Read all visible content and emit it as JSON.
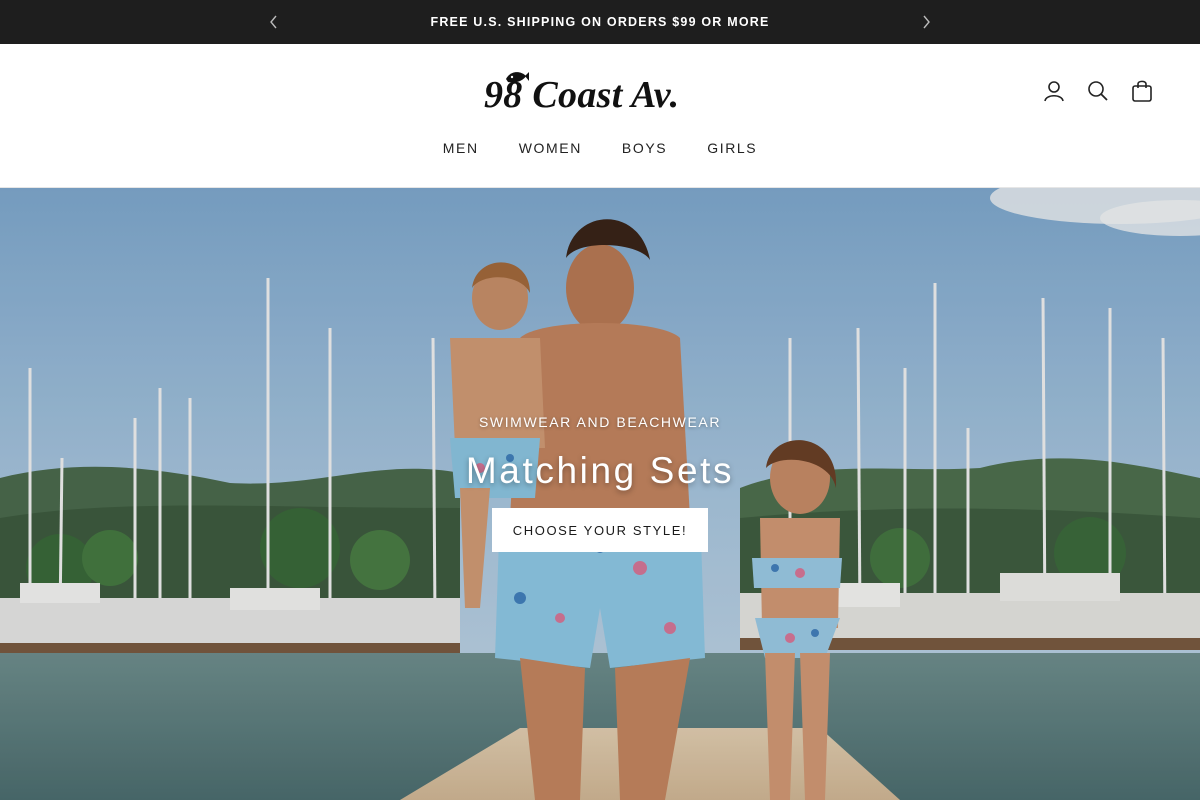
{
  "announcement": {
    "text": "FREE U.S. SHIPPING ON ORDERS $99 OR MORE",
    "prev_icon": "chevron-left-icon",
    "next_icon": "chevron-right-icon"
  },
  "header": {
    "logo_text": "98 Coast Av.",
    "icons": [
      "account-icon",
      "search-icon",
      "cart-bag-icon"
    ]
  },
  "nav": {
    "items": [
      {
        "label": "MEN"
      },
      {
        "label": "WOMEN"
      },
      {
        "label": "BOYS"
      },
      {
        "label": "GIRLS"
      }
    ]
  },
  "hero": {
    "eyebrow": "SWIMWEAR AND BEACHWEAR",
    "title": "Matching Sets",
    "button_label": "CHOOSE YOUR STYLE!"
  },
  "colors": {
    "announcement_bg": "#1e1e1e",
    "text_dark": "#1a1a1a",
    "button_bg": "#ffffff"
  }
}
